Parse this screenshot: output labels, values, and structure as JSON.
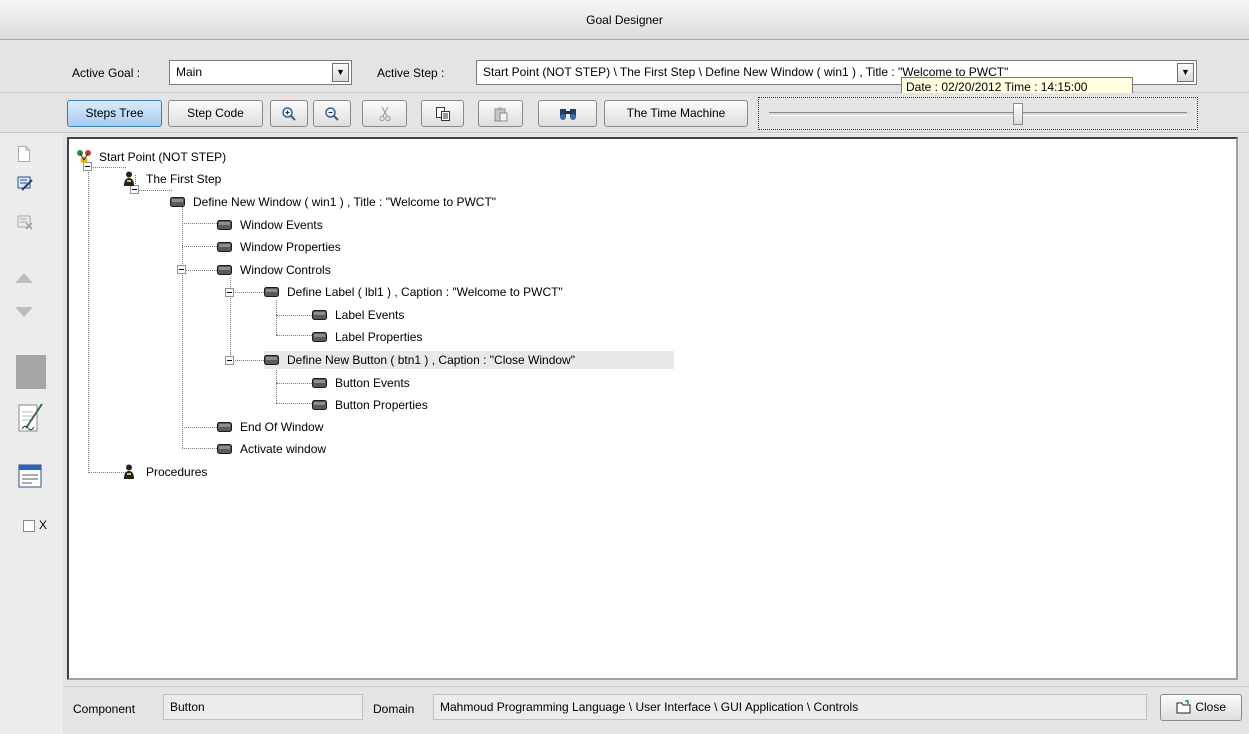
{
  "window": {
    "title": "Goal Designer"
  },
  "goal_bar": {
    "active_goal_label": "Active Goal :",
    "active_goal_value": "Main",
    "active_step_label": "Active Step :",
    "active_step_value": "Start Point (NOT STEP) \\ The First Step \\ Define New Window ( win1 ) , Title : \"Welcome to PWCT\"",
    "tooltip": "Date : 02/20/2012 Time : 14:15:00"
  },
  "toolbar": {
    "steps_tree": "Steps Tree",
    "step_code": "Step Code",
    "time_machine": "The Time Machine",
    "icons": [
      "zoom-in-icon",
      "zoom-out-icon",
      "cut-icon",
      "copy-icon",
      "paste-icon",
      "find-icon"
    ]
  },
  "sidebar": {
    "icons": [
      "new-page-icon",
      "edit-step-icon",
      "delete-step-icon",
      "move-up-icon",
      "move-down-icon",
      "color-swatch-icon",
      "notes-icon",
      "window-icon"
    ],
    "checkbox_label": "X"
  },
  "tree": {
    "nodes": [
      {
        "label": "Start Point (NOT STEP)",
        "icon": "group-icon"
      },
      {
        "label": "The First Step",
        "icon": "person-icon"
      },
      {
        "label": "Define New Window  ( win1 ) , Title : \"Welcome to PWCT\"",
        "icon": "step-icon"
      },
      {
        "label": "Window Events",
        "icon": "step-icon"
      },
      {
        "label": "Window Properties",
        "icon": "step-icon"
      },
      {
        "label": "Window Controls",
        "icon": "step-icon"
      },
      {
        "label": "Define Label ( lbl1 ) , Caption : \"Welcome to PWCT\"",
        "icon": "step-icon"
      },
      {
        "label": "Label Events",
        "icon": "step-icon"
      },
      {
        "label": "Label Properties",
        "icon": "step-icon"
      },
      {
        "label": "Define New Button ( btn1 ) , Caption : \"Close Window\"",
        "icon": "step-icon",
        "selected": true
      },
      {
        "label": "Button Events",
        "icon": "step-icon"
      },
      {
        "label": "Button Properties",
        "icon": "step-icon"
      },
      {
        "label": "End Of Window",
        "icon": "step-icon"
      },
      {
        "label": "Activate window",
        "icon": "step-icon"
      },
      {
        "label": "Procedures",
        "icon": "person-icon"
      }
    ]
  },
  "statusbar": {
    "component_label": "Component",
    "component_value": "Button",
    "domain_label": "Domain",
    "domain_value": "Mahmoud Programming Language \\ User Interface \\ GUI Application \\ Controls",
    "close_label": "Close"
  }
}
